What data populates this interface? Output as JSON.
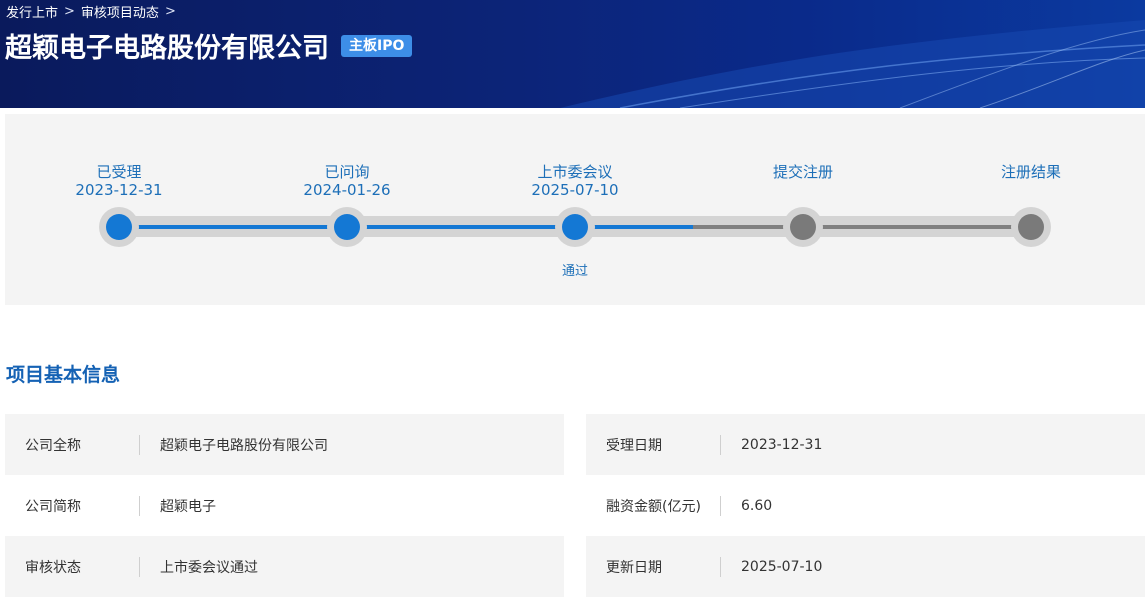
{
  "breadcrumb": {
    "items": [
      "发行上市",
      "审核项目动态"
    ],
    "separator": ">"
  },
  "header": {
    "title": "超颖电子电路股份有限公司",
    "badge": "主板IPO"
  },
  "progress": {
    "steps": [
      {
        "name": "已受理",
        "date": "2023-12-31",
        "status": "done"
      },
      {
        "name": "已问询",
        "date": "2024-01-26",
        "status": "done"
      },
      {
        "name": "上市委会议",
        "date": "2025-07-10",
        "status": "done",
        "result": "通过"
      },
      {
        "name": "提交注册",
        "date": "",
        "status": "pending"
      },
      {
        "name": "注册结果",
        "date": "",
        "status": "pending"
      }
    ]
  },
  "section": {
    "title": "项目基本信息"
  },
  "info": {
    "left": [
      {
        "label": "公司全称",
        "value": "超颖电子电路股份有限公司"
      },
      {
        "label": "公司简称",
        "value": "超颖电子"
      },
      {
        "label": "审核状态",
        "value": "上市委会议通过"
      }
    ],
    "right": [
      {
        "label": "受理日期",
        "value": "2023-12-31"
      },
      {
        "label": "融资金额(亿元)",
        "value": "6.60"
      },
      {
        "label": "更新日期",
        "value": "2025-07-10"
      }
    ]
  },
  "colors": {
    "accent": "#1478d4",
    "banner": "#0c2478",
    "badge": "#3d8ee8",
    "pending": "#7a7a7a"
  }
}
